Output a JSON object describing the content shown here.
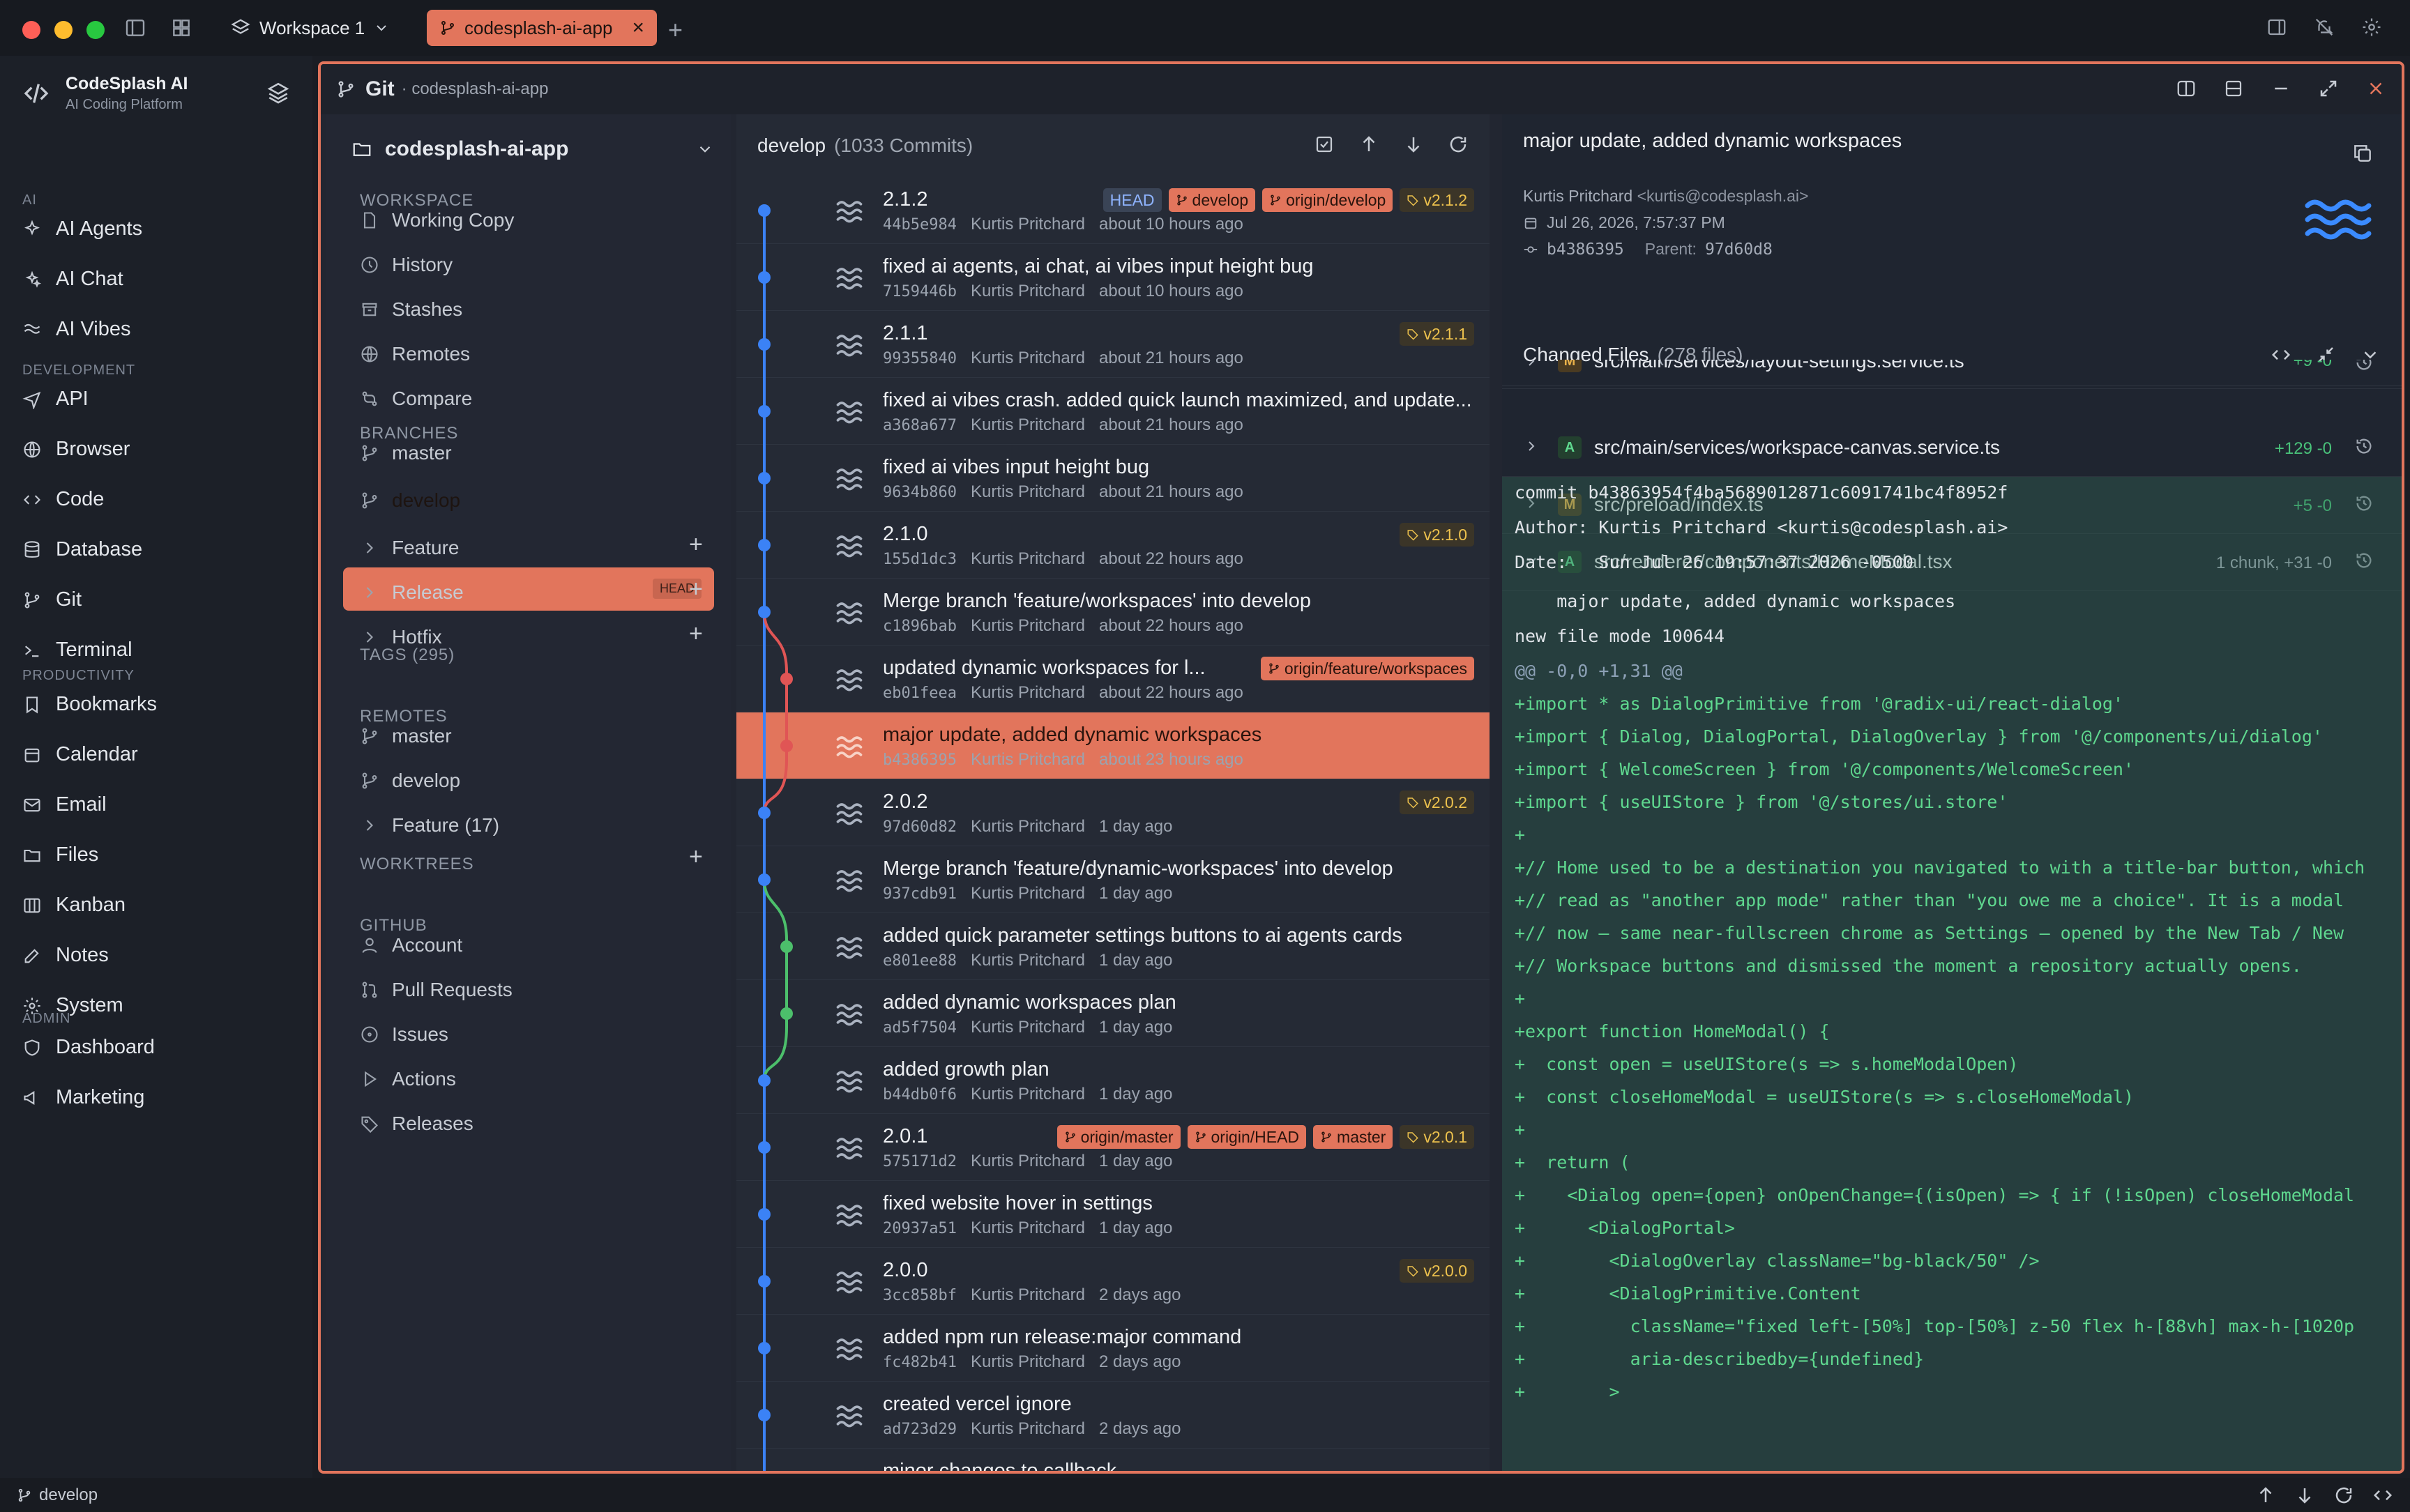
{
  "window": {
    "workspace_label": "Workspace 1",
    "active_tab": "codesplash-ai-app"
  },
  "brand": {
    "name": "CodeSplash AI",
    "subtitle": "AI Coding Platform"
  },
  "nav": {
    "sections": [
      {
        "title": "AI",
        "items": [
          "AI Agents",
          "AI Chat",
          "AI Vibes"
        ]
      },
      {
        "title": "DEVELOPMENT",
        "items": [
          "API",
          "Browser",
          "Code",
          "Database",
          "Git",
          "Terminal"
        ]
      },
      {
        "title": "PRODUCTIVITY",
        "items": [
          "Bookmarks",
          "Calendar",
          "Email",
          "Files",
          "Kanban",
          "Notes",
          "System"
        ]
      },
      {
        "title": "ADMIN",
        "items": [
          "Dashboard",
          "Marketing"
        ]
      }
    ]
  },
  "panel": {
    "title": "Git",
    "subtitle": "· codesplash-ai-app"
  },
  "repo": {
    "name": "codesplash-ai-app",
    "workspace_header": "WORKSPACE",
    "workspace_items": [
      "Working Copy",
      "History",
      "Stashes",
      "Remotes",
      "Compare"
    ],
    "branches_header": "BRANCHES",
    "branches": [
      "master",
      "develop"
    ],
    "head_badge": "HEAD",
    "branch_groups": [
      "Feature",
      "Release",
      "Hotfix"
    ],
    "tags_header": "TAGS (295)",
    "remotes_header": "REMOTES",
    "remotes": [
      "master",
      "develop",
      "Feature (17)"
    ],
    "worktrees_header": "WORKTREES",
    "github_header": "GITHUB",
    "github_items": [
      "Account",
      "Pull Requests",
      "Issues",
      "Actions",
      "Releases"
    ]
  },
  "commits_header": {
    "branch": "develop",
    "count": "(1033 Commits)"
  },
  "commits": [
    {
      "title": "2.1.2",
      "hash": "44b5e984",
      "author": "Kurtis Pritchard",
      "time": "about 10 hours ago",
      "badges": [
        {
          "t": "HEAD",
          "k": "head"
        },
        {
          "t": "develop",
          "k": "br"
        },
        {
          "t": "origin/develop",
          "k": "br"
        },
        {
          "t": "v2.1.2",
          "k": "tag"
        }
      ]
    },
    {
      "title": "fixed ai agents, ai chat, ai vibes input height bug",
      "hash": "7159446b",
      "author": "Kurtis Pritchard",
      "time": "about 10 hours ago",
      "badges": []
    },
    {
      "title": "2.1.1",
      "hash": "99355840",
      "author": "Kurtis Pritchard",
      "time": "about 21 hours ago",
      "badges": [
        {
          "t": "v2.1.1",
          "k": "tag"
        }
      ]
    },
    {
      "title": "fixed ai vibes crash. added quick launch maximized, and update...",
      "hash": "a368a677",
      "author": "Kurtis Pritchard",
      "time": "about 21 hours ago",
      "badges": []
    },
    {
      "title": "fixed ai vibes input height bug",
      "hash": "9634b860",
      "author": "Kurtis Pritchard",
      "time": "about 21 hours ago",
      "badges": []
    },
    {
      "title": "2.1.0",
      "hash": "155d1dc3",
      "author": "Kurtis Pritchard",
      "time": "about 22 hours ago",
      "badges": [
        {
          "t": "v2.1.0",
          "k": "tag"
        }
      ]
    },
    {
      "title": "Merge branch 'feature/workspaces' into develop",
      "hash": "c1896bab",
      "author": "Kurtis Pritchard",
      "time": "about 22 hours ago",
      "badges": []
    },
    {
      "title": "updated dynamic workspaces for l...",
      "hash": "eb01feea",
      "author": "Kurtis Pritchard",
      "time": "about 22 hours ago",
      "badges": [
        {
          "t": "origin/feature/workspaces",
          "k": "br"
        }
      ]
    },
    {
      "title": "major update, added dynamic workspaces",
      "hash": "b4386395",
      "author": "Kurtis Pritchard",
      "time": "about 23 hours ago",
      "badges": []
    },
    {
      "title": "2.0.2",
      "hash": "97d60d82",
      "author": "Kurtis Pritchard",
      "time": "1 day ago",
      "badges": [
        {
          "t": "v2.0.2",
          "k": "tag"
        }
      ]
    },
    {
      "title": "Merge branch 'feature/dynamic-workspaces' into develop",
      "hash": "937cdb91",
      "author": "Kurtis Pritchard",
      "time": "1 day ago",
      "badges": []
    },
    {
      "title": "added quick parameter settings buttons to ai agents cards",
      "hash": "e801ee88",
      "author": "Kurtis Pritchard",
      "time": "1 day ago",
      "badges": []
    },
    {
      "title": "added dynamic workspaces plan",
      "hash": "ad5f7504",
      "author": "Kurtis Pritchard",
      "time": "1 day ago",
      "badges": []
    },
    {
      "title": "added growth plan",
      "hash": "b44db0f6",
      "author": "Kurtis Pritchard",
      "time": "1 day ago",
      "badges": []
    },
    {
      "title": "2.0.1",
      "hash": "575171d2",
      "author": "Kurtis Pritchard",
      "time": "1 day ago",
      "badges": [
        {
          "t": "origin/master",
          "k": "br"
        },
        {
          "t": "origin/HEAD",
          "k": "br"
        },
        {
          "t": "master",
          "k": "br"
        },
        {
          "t": "v2.0.1",
          "k": "tag"
        }
      ]
    },
    {
      "title": "fixed website hover in settings",
      "hash": "20937a51",
      "author": "Kurtis Pritchard",
      "time": "1 day ago",
      "badges": []
    },
    {
      "title": "2.0.0",
      "hash": "3cc858bf",
      "author": "Kurtis Pritchard",
      "time": "2 days ago",
      "badges": [
        {
          "t": "v2.0.0",
          "k": "tag"
        }
      ]
    },
    {
      "title": "added npm run release:major command",
      "hash": "fc482b41",
      "author": "Kurtis Pritchard",
      "time": "2 days ago",
      "badges": []
    },
    {
      "title": "created vercel ignore",
      "hash": "ad723d29",
      "author": "Kurtis Pritchard",
      "time": "2 days ago",
      "badges": []
    },
    {
      "title": "minor changes to callback",
      "hash": "",
      "author": "",
      "time": "",
      "badges": []
    }
  ],
  "selected_commit_index": 8,
  "detail": {
    "title": "major update, added dynamic workspaces",
    "author": "Kurtis Pritchard",
    "email": "<kurtis@codesplash.ai>",
    "date": "Jul 26, 2026, 7:57:37 PM",
    "hash": "b4386395",
    "parent_label": "Parent:",
    "parent": "97d60d8",
    "changed_files_label": "Changed Files",
    "changed_files_count": "(278 files)",
    "files": [
      {
        "status": "M",
        "path": "src/main/services/layout-settings.service.ts",
        "stat": "+9 -0"
      },
      {
        "status": "A",
        "path": "src/main/services/workspace-canvas.service.ts",
        "stat": "+129 -0"
      },
      {
        "status": "M",
        "path": "src/preload/index.ts",
        "stat": "+5 -0"
      },
      {
        "status": "A",
        "path": "src/renderer/components/HomeModal.tsx",
        "stat": "1 chunk, +31 -0"
      }
    ],
    "diff": [
      {
        "t": "commit b43863954f4ba5689012871c6091741bc4f8952f",
        "k": "meta"
      },
      {
        "t": "Author: Kurtis Pritchard <kurtis@codesplash.ai>",
        "k": "meta"
      },
      {
        "t": "Date:   Sun Jul 26 19:57:37 2026 -0500",
        "k": "meta"
      },
      {
        "t": "",
        "k": "meta"
      },
      {
        "t": "    major update, added dynamic workspaces",
        "k": "meta"
      },
      {
        "t": "",
        "k": "meta"
      },
      {
        "t": "new file mode 100644",
        "k": "meta"
      },
      {
        "t": "@@ -0,0 +1,31 @@",
        "k": "hunk"
      },
      {
        "t": "+import * as DialogPrimitive from '@radix-ui/react-dialog'",
        "k": "add"
      },
      {
        "t": "+import { Dialog, DialogPortal, DialogOverlay } from '@/components/ui/dialog'",
        "k": "add"
      },
      {
        "t": "+import { WelcomeScreen } from '@/components/WelcomeScreen'",
        "k": "add"
      },
      {
        "t": "+import { useUIStore } from '@/stores/ui.store'",
        "k": "add"
      },
      {
        "t": "+",
        "k": "add"
      },
      {
        "t": "+// Home used to be a destination you navigated to with a title-bar button, which",
        "k": "add"
      },
      {
        "t": "+// read as \"another app mode\" rather than \"you owe me a choice\". It is a modal",
        "k": "add"
      },
      {
        "t": "+// now — same near-fullscreen chrome as Settings — opened by the New Tab / New",
        "k": "add"
      },
      {
        "t": "+// Workspace buttons and dismissed the moment a repository actually opens.",
        "k": "add"
      },
      {
        "t": "+",
        "k": "add"
      },
      {
        "t": "+export function HomeModal() {",
        "k": "add"
      },
      {
        "t": "+  const open = useUIStore(s => s.homeModalOpen)",
        "k": "add"
      },
      {
        "t": "+  const closeHomeModal = useUIStore(s => s.closeHomeModal)",
        "k": "add"
      },
      {
        "t": "+",
        "k": "add"
      },
      {
        "t": "+  return (",
        "k": "add"
      },
      {
        "t": "+    <Dialog open={open} onOpenChange={(isOpen) => { if (!isOpen) closeHomeModal",
        "k": "add"
      },
      {
        "t": "+      <DialogPortal>",
        "k": "add"
      },
      {
        "t": "+        <DialogOverlay className=\"bg-black/50\" />",
        "k": "add"
      },
      {
        "t": "+        <DialogPrimitive.Content",
        "k": "add"
      },
      {
        "t": "+          className=\"fixed left-[50%] top-[50%] z-50 flex h-[88vh] max-h-[1020p",
        "k": "add"
      },
      {
        "t": "+          aria-describedby={undefined}",
        "k": "add"
      },
      {
        "t": "+        >",
        "k": "add"
      }
    ]
  },
  "statusbar": {
    "branch": "develop"
  },
  "colors": {
    "accent": "#e2755c",
    "graph_blue": "#3b82f6",
    "graph_red": "#e05555",
    "graph_green": "#4cbf6b",
    "add_green": "#5fd88f"
  }
}
